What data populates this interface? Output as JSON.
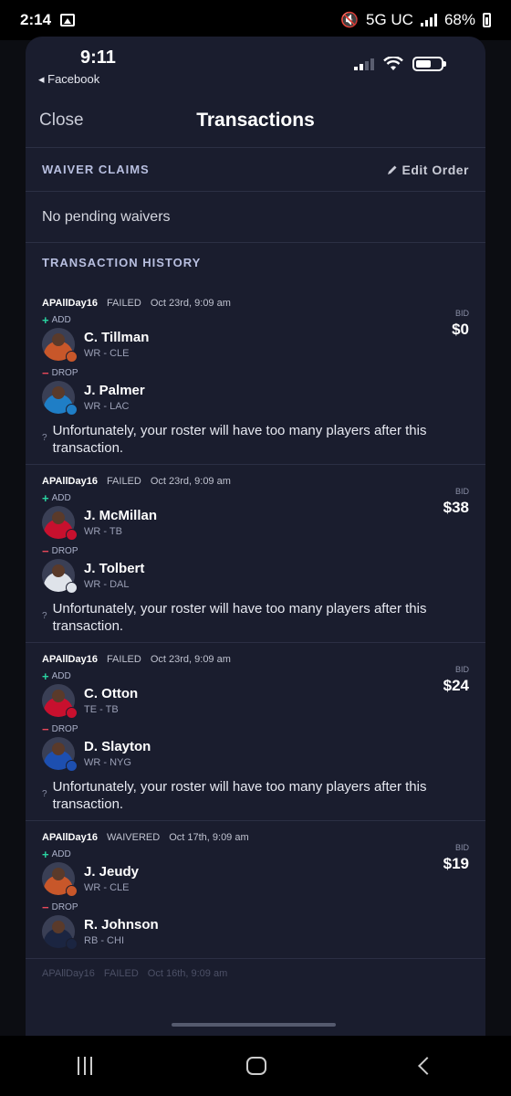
{
  "android_status": {
    "time": "2:14",
    "network": "5G UC",
    "battery": "68%"
  },
  "ios_status": {
    "time": "9:11",
    "back_label": "◂ Facebook"
  },
  "nav": {
    "close_label": "Close",
    "title": "Transactions"
  },
  "waiver": {
    "title": "WAIVER CLAIMS",
    "edit_label": "Edit Order",
    "empty_text": "No pending waivers"
  },
  "history": {
    "title": "TRANSACTION HISTORY"
  },
  "transactions": [
    {
      "user": "APAllDay16",
      "status": "FAILED",
      "date": "Oct 23rd, 9:09 am",
      "add_label": "ADD",
      "drop_label": "DROP",
      "bid_label": "BID",
      "bid": "$0",
      "add_player": {
        "name": "C. Tillman",
        "pos": "WR - CLE",
        "color": "#c8572a",
        "skin": "#3d2a20"
      },
      "drop_player": {
        "name": "J. Palmer",
        "pos": "WR - LAC",
        "color": "#1f7ec6",
        "skin": "#4a3224"
      },
      "message": "Unfortunately, your roster will have too many players after this transaction."
    },
    {
      "user": "APAllDay16",
      "status": "FAILED",
      "date": "Oct 23rd, 9:09 am",
      "add_label": "ADD",
      "drop_label": "DROP",
      "bid_label": "BID",
      "bid": "$38",
      "add_player": {
        "name": "J. McMillan",
        "pos": "WR - TB",
        "color": "#c8102e",
        "skin": "#3b2a22"
      },
      "drop_player": {
        "name": "J. Tolbert",
        "pos": "WR - DAL",
        "color": "#dfe3ea",
        "skin": "#3d2a20"
      },
      "message": "Unfortunately, your roster will have too many players after this transaction."
    },
    {
      "user": "APAllDay16",
      "status": "FAILED",
      "date": "Oct 23rd, 9:09 am",
      "add_label": "ADD",
      "drop_label": "DROP",
      "bid_label": "BID",
      "bid": "$24",
      "add_player": {
        "name": "C. Otton",
        "pos": "TE - TB",
        "color": "#c8102e",
        "skin": "#d9a27e"
      },
      "drop_player": {
        "name": "D. Slayton",
        "pos": "WR - NYG",
        "color": "#1d4fb0",
        "skin": "#3d2a20"
      },
      "message": "Unfortunately, your roster will have too many players after this transaction."
    },
    {
      "user": "APAllDay16",
      "status": "WAIVERED",
      "date": "Oct 17th, 9:09 am",
      "add_label": "ADD",
      "drop_label": "DROP",
      "bid_label": "BID",
      "bid": "$19",
      "add_player": {
        "name": "J. Jeudy",
        "pos": "WR - CLE",
        "color": "#c8572a",
        "skin": "#3d2a20"
      },
      "drop_player": {
        "name": "R. Johnson",
        "pos": "RB - CHI",
        "color": "#1b2541",
        "skin": "#3d2a20"
      },
      "message": ""
    }
  ],
  "partial_row": {
    "user": "APAllDay16",
    "status": "FAILED",
    "date": "Oct 16th, 9:09 am"
  }
}
